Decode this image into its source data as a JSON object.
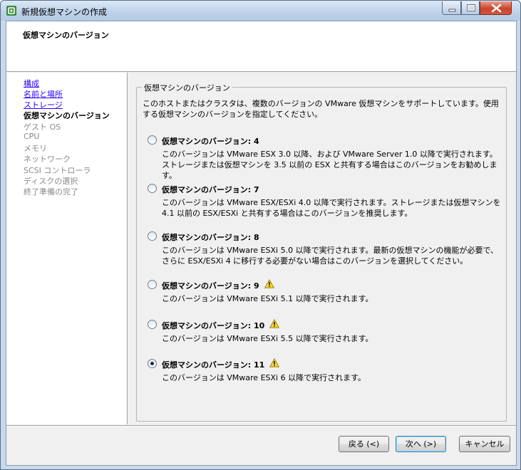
{
  "window": {
    "title": "新規仮想マシンの作成"
  },
  "header": {
    "title": "仮想マシンのバージョン"
  },
  "steps": [
    {
      "label": "構成",
      "state": "link"
    },
    {
      "label": "名前と場所",
      "state": "link"
    },
    {
      "label": "ストレージ",
      "state": "link"
    },
    {
      "label": "仮想マシンのバージョン",
      "state": "current"
    },
    {
      "label": "ゲスト OS",
      "state": "future"
    },
    {
      "label": "CPU",
      "state": "future"
    },
    {
      "label": "メモリ",
      "state": "future"
    },
    {
      "label": "ネットワーク",
      "state": "future"
    },
    {
      "label": "SCSI コントローラ",
      "state": "future"
    },
    {
      "label": "ディスクの選択",
      "state": "future"
    },
    {
      "label": "終了準備の完了",
      "state": "future"
    }
  ],
  "group": {
    "title": "仮想マシンのバージョン",
    "intro": "このホストまたはクラスタは、複数のバージョンの VMware 仮想マシンをサポートしています。使用する仮想マシンのバージョンを指定してください。"
  },
  "options": [
    {
      "label": "仮想マシンのバージョン: 4",
      "description": "このバージョンは VMware ESX 3.0 以降、および VMware Server 1.0 以降で実行されます。ストレージまたは仮想マシンを 3.5 以前の ESX と共有する場合はこのバージョンをお勧めします。",
      "warning": false,
      "selected": false
    },
    {
      "label": "仮想マシンのバージョン: 7",
      "description": "このバージョンは VMware ESX/ESXi 4.0 以降で実行されます。ストレージまたは仮想マシンを 4.1 以前の ESX/ESXi と共有する場合はこのバージョンを推奨します。",
      "warning": false,
      "selected": false
    },
    {
      "label": "仮想マシンのバージョン: 8",
      "description": "このバージョンは VMware ESXi 5.0 以降で実行されます。最新の仮想マシンの機能が必要で、さらに ESX/ESXi 4 に移行する必要がない場合はこのバージョンを選択してください。",
      "warning": false,
      "selected": false
    },
    {
      "label": "仮想マシンのバージョン: 9",
      "description": "このバージョンは VMware ESXi 5.1 以降で実行されます。",
      "warning": true,
      "selected": false
    },
    {
      "label": "仮想マシンのバージョン: 10",
      "description": "このバージョンは VMware ESXi 5.5 以降で実行されます。",
      "warning": true,
      "selected": false
    },
    {
      "label": "仮想マシンのバージョン: 11",
      "description": "このバージョンは VMware ESXi 6 以降で実行されます。",
      "warning": true,
      "selected": true
    }
  ],
  "buttons": {
    "back": "戻る (<)",
    "next": "次へ (>)",
    "cancel": "キャンセル"
  },
  "icons": {
    "app": "vsphere-logo-icon",
    "warning": "warning-triangle-icon",
    "minimize": "minimize-icon",
    "maximize": "maximize-icon",
    "close": "close-icon"
  }
}
